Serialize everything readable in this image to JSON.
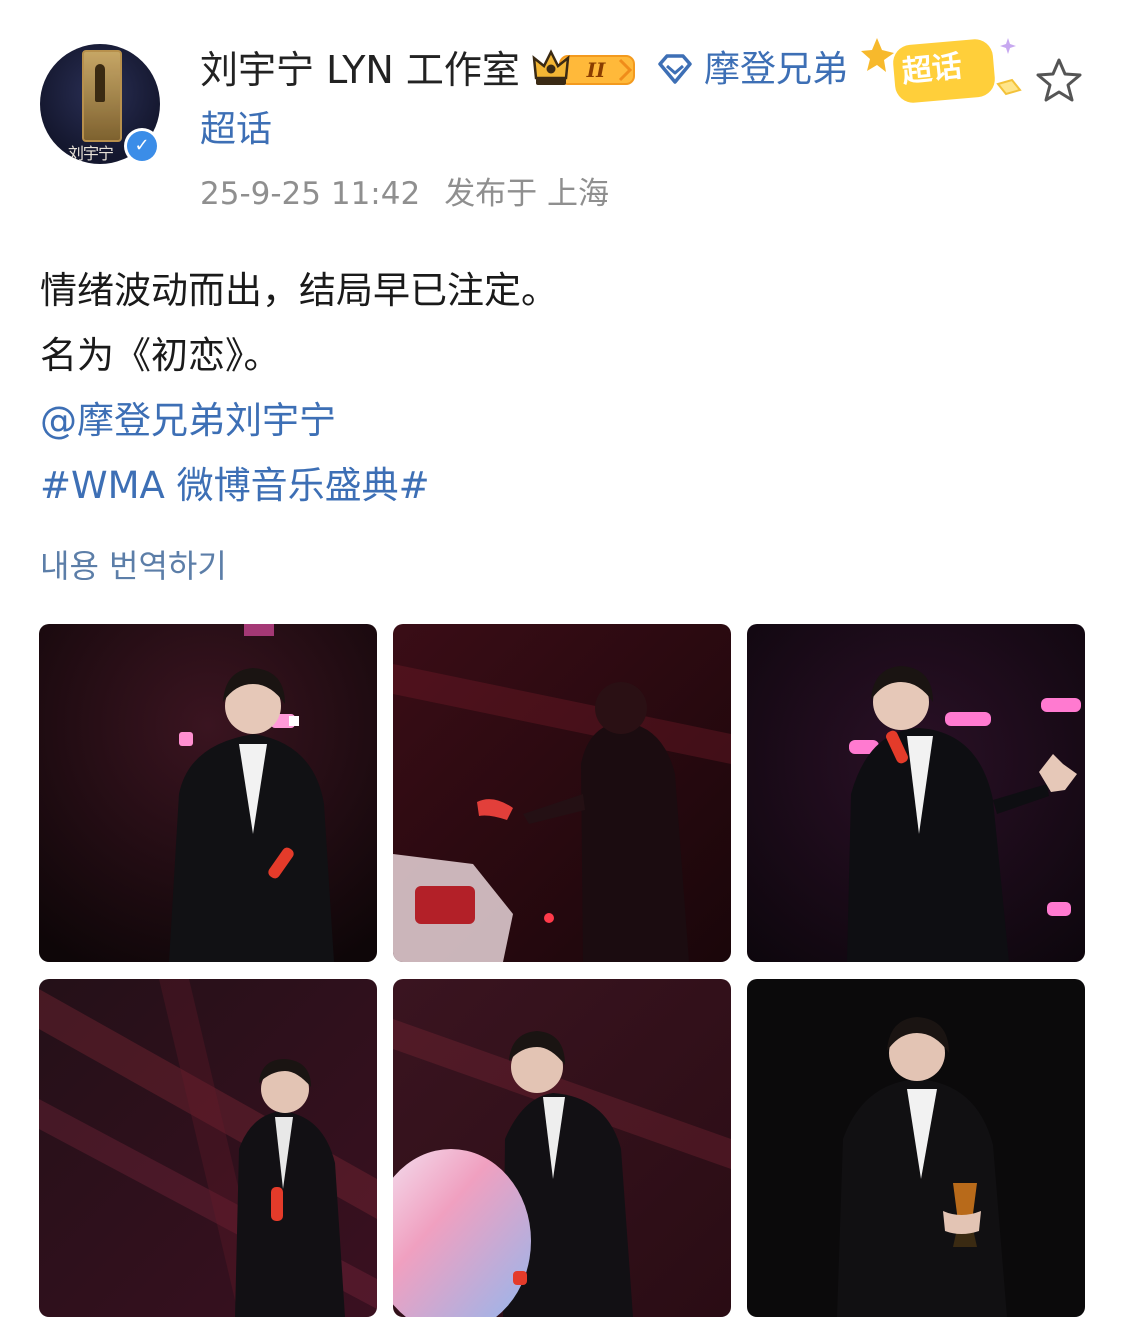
{
  "post": {
    "author_name": "刘宇宁 LYN 工作室",
    "fan_group": "摩登兄弟",
    "fan_group_suffix": "超话",
    "crown_level": "II",
    "supertopic_label": "超话",
    "timestamp": "25-9-25 11:42",
    "location": "发布于 上海",
    "avatar_signature": "刘宇宁",
    "lines": [
      "情绪波动而出，结局早已注定。",
      "名为《初恋》。"
    ],
    "mention": "@摩登兄弟刘宇宁",
    "hashtag": "#WMA 微博音乐盛典#",
    "translate_label": "내용 번역하기"
  },
  "photos": [
    {
      "alt": "photo-1",
      "tone": "dark-red-stage"
    },
    {
      "alt": "photo-2",
      "tone": "red-blur"
    },
    {
      "alt": "photo-3",
      "tone": "pink-lights"
    },
    {
      "alt": "photo-4",
      "tone": "red-beams"
    },
    {
      "alt": "photo-5",
      "tone": "pink-lights"
    },
    {
      "alt": "photo-6",
      "tone": "dark-trophy"
    }
  ],
  "colors": {
    "link": "#3d6fb5",
    "meta": "#8f8f8f",
    "verified": "#3b8de8",
    "supertopic_yellow": "#ffcf3a"
  },
  "icons": {
    "verified": "verified-check-icon",
    "crown": "crown-icon",
    "fan": "diamond-icon",
    "star": "star-outline-icon"
  }
}
